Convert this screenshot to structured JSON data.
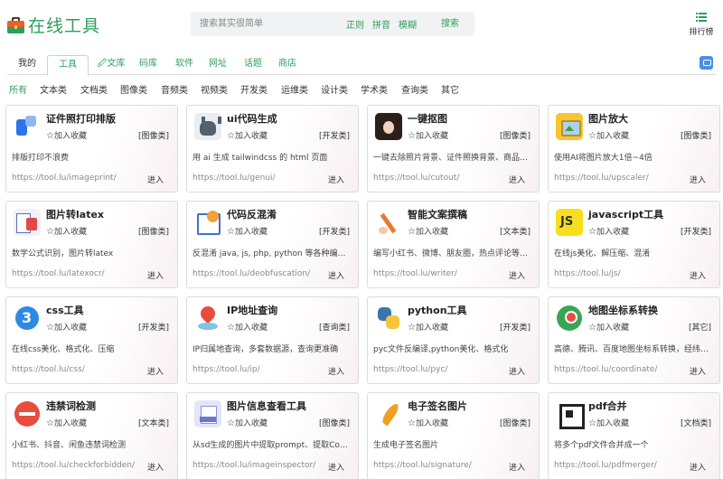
{
  "header": {
    "logo_text": "在线工具",
    "search_placeholder": "搜索其实很简单",
    "search_modes": [
      "正则",
      "拼音",
      "模糊"
    ],
    "search_button": "搜索",
    "rank_label": "排行榜"
  },
  "tabs": [
    "我的",
    "工具",
    "文库",
    "码库",
    "软件",
    "网址",
    "话题",
    "商店"
  ],
  "active_tab": "工具",
  "categories": [
    "所有",
    "文本类",
    "文档类",
    "图像类",
    "音频类",
    "视频类",
    "开发类",
    "运维类",
    "设计类",
    "学术类",
    "查询类",
    "其它"
  ],
  "active_category": "所有",
  "fav_label": "加入收藏",
  "enter_label": "进入",
  "cards": [
    {
      "name": "证件照打印排版",
      "tag": "[图像类]",
      "desc": "排版打印不浪费",
      "url": "https://tool.lu/imageprint/",
      "icon": "id-photo-icon"
    },
    {
      "name": "ui代码生成",
      "tag": "[开发类]",
      "desc": "用 ai 生成 tailwindcss 的 html 页面",
      "url": "https://tool.lu/genui/",
      "icon": "github-cat-icon"
    },
    {
      "name": "一键抠图",
      "tag": "[图像类]",
      "desc": "一键去除照片背景、证件照换背景、商品白...",
      "url": "https://tool.lu/cutout/",
      "icon": "portrait-icon"
    },
    {
      "name": "图片放大",
      "tag": "[图像类]",
      "desc": "使用AI将图片放大1倍~4倍",
      "url": "https://tool.lu/upscaler/",
      "icon": "picture-icon"
    },
    {
      "name": "图片转latex",
      "tag": "[图像类]",
      "desc": "数学公式识别，图片转latex",
      "url": "https://tool.lu/latexocr/",
      "icon": "latex-icon"
    },
    {
      "name": "代码反混淆",
      "tag": "[开发类]",
      "desc": "反混淆 java, js, php, python 等各种编程...",
      "url": "https://tool.lu/deobfuscation/",
      "icon": "code-icon"
    },
    {
      "name": "智能文案撰稿",
      "tag": "[文本类]",
      "desc": "编写小红书、微博、朋友圈，热点评论等文案",
      "url": "https://tool.lu/writer/",
      "icon": "writing-hand-icon"
    },
    {
      "name": "javascript工具",
      "tag": "[开发类]",
      "desc": "在线js美化、解压缩、混淆",
      "url": "https://tool.lu/js/",
      "icon": "js-icon"
    },
    {
      "name": "css工具",
      "tag": "[开发类]",
      "desc": "在线css美化、格式化、压缩",
      "url": "https://tool.lu/css/",
      "icon": "css-icon"
    },
    {
      "name": "IP地址查询",
      "tag": "[查询类]",
      "desc": "IP归属地查询，多套数据源，查询更准确",
      "url": "https://tool.lu/ip/",
      "icon": "ip-location-icon"
    },
    {
      "name": "python工具",
      "tag": "[开发类]",
      "desc": "pyc文件反编译,python美化、格式化",
      "url": "https://tool.lu/pyc/",
      "icon": "python-icon"
    },
    {
      "name": "地图坐标系转换",
      "tag": "[其它]",
      "desc": "高德、腾讯、百度地图坐标系转换，经纬度...",
      "url": "https://tool.lu/coordinate/",
      "icon": "map-icon"
    },
    {
      "name": "违禁词检测",
      "tag": "[文本类]",
      "desc": "小红书、抖音、闲鱼违禁词检测",
      "url": "https://tool.lu/checkforbidden/",
      "icon": "ban-icon"
    },
    {
      "name": "图片信息查看工具",
      "tag": "[图像类]",
      "desc": "从sd生成的图片中提取prompt、提取Comf...",
      "url": "https://tool.lu/imageinspector/",
      "icon": "exif-icon"
    },
    {
      "name": "电子签名图片",
      "tag": "[图像类]",
      "desc": "生成电子签名图片",
      "url": "https://tool.lu/signature/",
      "icon": "signature-feather-icon"
    },
    {
      "name": "pdf合并",
      "tag": "[文档类]",
      "desc": "将多个pdf文件合并成一个",
      "url": "https://tool.lu/pdfmerger/",
      "icon": "pdf-merge-icon"
    }
  ]
}
